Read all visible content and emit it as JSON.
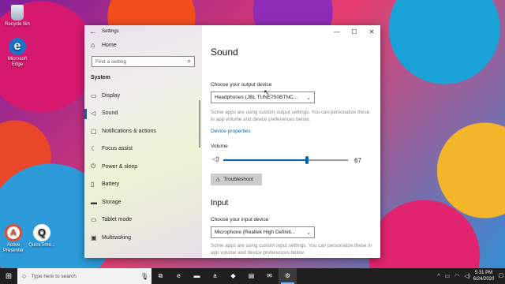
{
  "desktop": {
    "icons": [
      {
        "label": "Recycle Bin",
        "icon": "recycle-bin-icon"
      },
      {
        "label": "Microsoft Edge",
        "icon": "edge-icon"
      },
      {
        "label": "Active Presenter",
        "icon": "active-presenter-icon"
      },
      {
        "label": "QuickTime...",
        "icon": "quicktime-icon"
      }
    ]
  },
  "window": {
    "title": "Settings",
    "back_icon": "←",
    "minimize": "—",
    "maximize": "☐",
    "close": "✕"
  },
  "sidebar": {
    "home_label": "Home",
    "search_placeholder": "Find a setting",
    "section_title": "System",
    "items": [
      {
        "label": "Display",
        "icon": "monitor-icon"
      },
      {
        "label": "Sound",
        "icon": "speaker-icon",
        "active": true
      },
      {
        "label": "Notifications & actions",
        "icon": "notification-icon"
      },
      {
        "label": "Focus assist",
        "icon": "moon-icon"
      },
      {
        "label": "Power & sleep",
        "icon": "power-icon"
      },
      {
        "label": "Battery",
        "icon": "battery-icon"
      },
      {
        "label": "Storage",
        "icon": "storage-icon"
      },
      {
        "label": "Tablet mode",
        "icon": "tablet-icon"
      },
      {
        "label": "Multitasking",
        "icon": "multitasking-icon"
      }
    ]
  },
  "main": {
    "title": "Sound",
    "output": {
      "label": "Choose your output device",
      "selected": "Headphones (JBL TUNE750BTNC...",
      "note": "Some apps are using custom output settings. You can personalize these in app volume and device preferences below.",
      "device_properties_link": "Device properties",
      "volume_label": "Volume",
      "volume_value": "67",
      "volume_level": 0.67,
      "troubleshoot_label": "Troubleshoot"
    },
    "input": {
      "heading": "Input",
      "label": "Choose your input device",
      "selected": "Microphone (Realtek High Definiti...",
      "note": "Some apps are using custom input settings. You can personalize these in app volume and device preferences below."
    }
  },
  "taskbar": {
    "search_placeholder": "Type here to search",
    "apps": [
      "task-view-icon",
      "edge-icon",
      "explorer-icon",
      "amazon-icon",
      "dropbox-icon",
      "store-icon",
      "mail-icon",
      "settings-icon"
    ],
    "clock_time": "5:31 PM",
    "clock_date": "6/24/2020"
  },
  "colors": {
    "accent": "#0063b1",
    "link": "#0066b4",
    "taskbar": "#1f1f1f"
  }
}
